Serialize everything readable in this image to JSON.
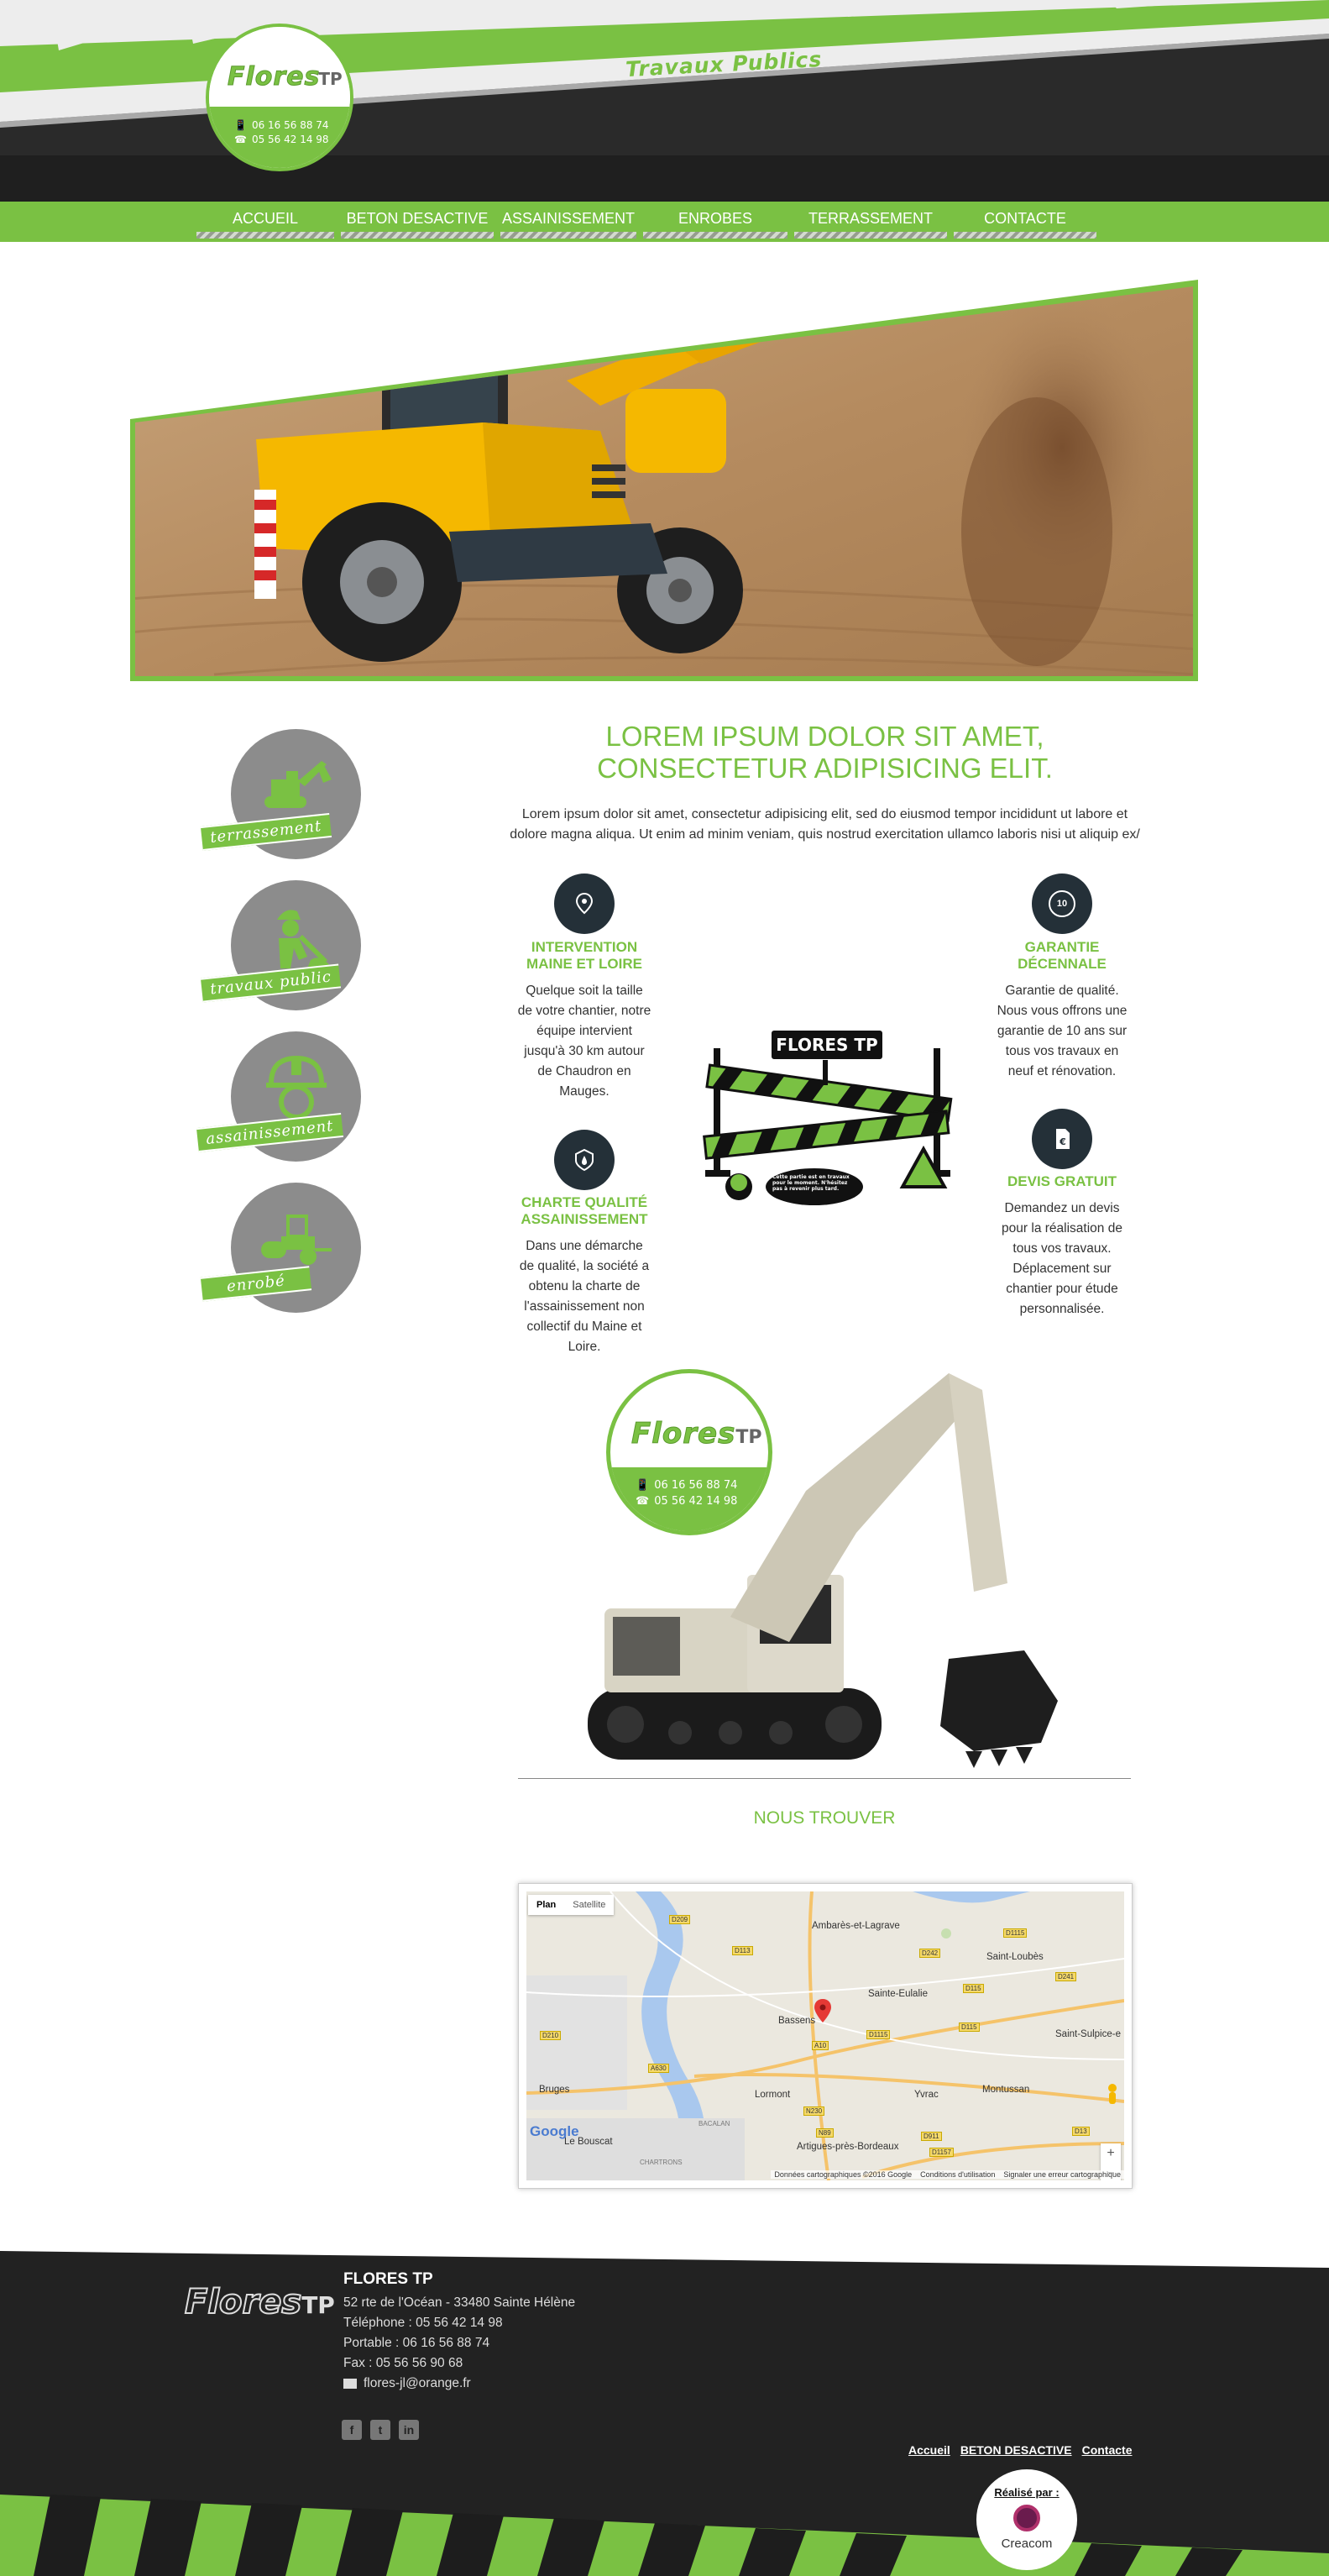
{
  "header": {
    "logo_word": "Flores",
    "logo_tp": "TP",
    "phone_mobile": "06 16 56 88 74",
    "phone_fixed": "05 56 42 14 98",
    "tagline": "Travaux Publics"
  },
  "nav": {
    "items": [
      {
        "label": "ACCUEIL"
      },
      {
        "label": "BETON DESACTIVE"
      },
      {
        "label": "ASSAINISSEMENT"
      },
      {
        "label": "ENROBES"
      },
      {
        "label": "TERRASSEMENT"
      },
      {
        "label": "CONTACTE"
      }
    ]
  },
  "intro": {
    "title_line1": "LOREM IPSUM DOLOR SIT AMET,",
    "title_line2": "CONSECTETUR ADIPISICING ELIT.",
    "text": "Lorem ipsum dolor sit amet, consectetur adipisicing elit, sed do eiusmod tempor incididunt ut labore et dolore magna aliqua. Ut enim ad minim veniam, quis nostrud exercitation ullamco laboris nisi ut aliquip ex/"
  },
  "services": [
    {
      "label": "terrassement",
      "icon": "excavator-icon"
    },
    {
      "label": "travaux public",
      "icon": "worker-icon"
    },
    {
      "label": "assainissement",
      "icon": "helmet-icon"
    },
    {
      "label": "enrobé",
      "icon": "roller-icon"
    }
  ],
  "features": {
    "intervention": {
      "icon": "location-pin-icon",
      "title_line1": "INTERVENTION",
      "title_line2": "MAINE ET LOIRE",
      "text": "Quelque soit la taille de votre chantier, notre équipe intervient jusqu'à 30 km autour de Chaudron en Mauges."
    },
    "qualite": {
      "icon": "shield-drop-icon",
      "title_line1": "CHARTE QUALITÉ",
      "title_line2": "ASSAINISSEMENT",
      "text": "Dans une démarche de qualité, la société a obtenu la charte de l'assainissement non collectif du Maine et Loire."
    },
    "garantie": {
      "icon": "badge-10-icon",
      "badge_text": "10",
      "title_line1": "GARANTIE",
      "title_line2": "DÉCENNALE",
      "text": "Garantie de qualité. Nous vous offrons une garantie de 10 ans sur tous vos travaux en neuf et rénovation."
    },
    "devis": {
      "icon": "document-euro-icon",
      "title_line1": "DEVIS GRATUIT",
      "text": "Demandez un devis pour la réalisation de tous vos travaux. Déplacement sur chantier pour étude personnalisée."
    }
  },
  "construction_sign": {
    "board_text": "FLORES TP",
    "bubble_text": "Cette partie est en travaux pour le moment. N'hésitez pas à revenir plus tard."
  },
  "find_us": {
    "title": "NOUS TROUVER",
    "map_tab_plan": "Plan",
    "map_tab_satellite": "Satellite",
    "map_places": [
      "Ambarès-et-Lagrave",
      "Saint-Loubès",
      "Sainte-Eulalie",
      "Bassens",
      "Saint-Sulpice-e",
      "Bruges",
      "Lormont",
      "Yvrac",
      "Montussan",
      "Le Bouscat",
      "Artigues-près-Bordeaux",
      "BACALAN",
      "CHARTRONS"
    ],
    "map_roads": [
      "D209",
      "D113",
      "D242",
      "D1115",
      "D241",
      "D115",
      "D210",
      "D1115",
      "A630",
      "D115",
      "D911",
      "A10",
      "N230",
      "N89",
      "D13",
      "D1157"
    ],
    "google": "Google",
    "attribution": "Données cartographiques ©2016 Google",
    "terms": "Conditions d'utilisation",
    "report": "Signaler une erreur cartographique",
    "zoom_in": "+",
    "zoom_out": "−"
  },
  "footer": {
    "company": "FLORES TP",
    "address": "52 rte de l'Océan - 33480 Sainte Hélène",
    "phone": "Téléphone : 05 56 42 14 98",
    "mobile": "Portable : 06 16 56 88 74",
    "fax": "Fax : 05 56 56 90 68",
    "email": "flores-jl@orange.fr",
    "links": [
      "Accueil",
      "BETON DESACTIVE",
      "Contacte"
    ],
    "realise": "Réalisé par :",
    "creacom": "Creacom"
  },
  "colors": {
    "accent": "#7ac143",
    "dark": "#222222",
    "icon_bg": "#243038"
  }
}
